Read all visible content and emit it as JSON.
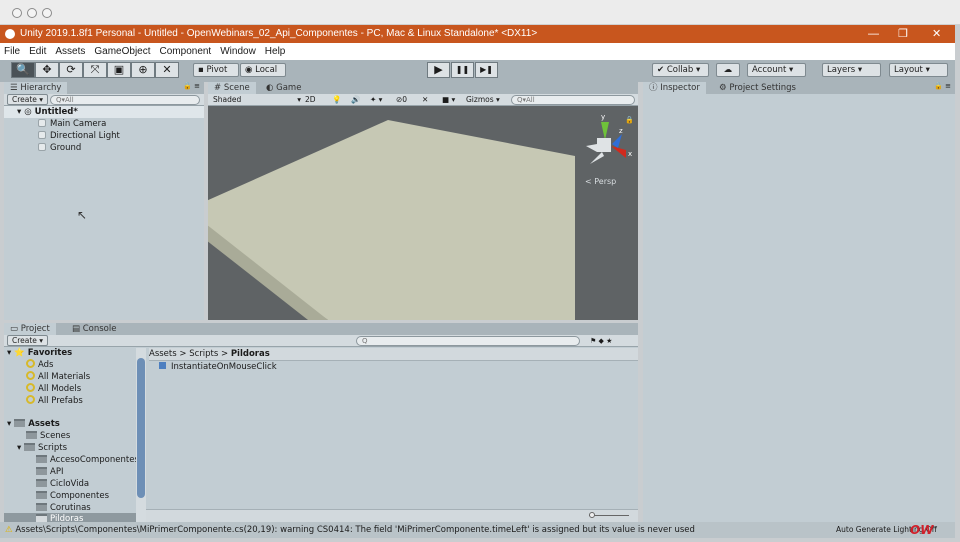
{
  "window": {
    "title": "Unity 2019.1.8f1 Personal - Untitled - OpenWebinars_02_Api_Componentes - PC, Mac & Linux Standalone* <DX11>",
    "minimize": "—",
    "restore": "❐",
    "close": "✕"
  },
  "menu": [
    "File",
    "Edit",
    "Assets",
    "GameObject",
    "Component",
    "Window",
    "Help"
  ],
  "toolbar": {
    "tools": [
      "🔍",
      "✥",
      "⟳",
      "⤧",
      "▣",
      "⊕",
      "✕"
    ],
    "pivot": "Pivot",
    "local": "Local",
    "play": "▶",
    "pause": "❚❚",
    "step": "▶❚",
    "collab": "Collab ▾",
    "account": "Account",
    "layers": "Layers",
    "layout": "Layout"
  },
  "hierarchy": {
    "tab": "Hierarchy",
    "create": "Create ▾",
    "search_placeholder": "Q▾All",
    "scene": "Untitled*",
    "items": [
      "Main Camera",
      "Directional Light",
      "Ground"
    ]
  },
  "scene": {
    "tabs": [
      "Scene",
      "Game"
    ],
    "shading": "Shaded",
    "mode_2d": "2D",
    "effects_count": "0",
    "gizmos": "Gizmos ▾",
    "search_placeholder": "Q▾All",
    "persp": "Persp",
    "axes": {
      "x": "x",
      "y": "y",
      "z": "z"
    },
    "colors": {
      "background": "#5f6365",
      "plane": "#c6c8b4"
    }
  },
  "inspector": {
    "tabs": [
      "Inspector",
      "Project Settings"
    ]
  },
  "project": {
    "tabs": [
      "Project",
      "Console"
    ],
    "create": "Create ▾",
    "favorites": {
      "label": "Favorites",
      "items": [
        "Ads",
        "All Materials",
        "All Models",
        "All Prefabs"
      ]
    },
    "assets": {
      "label": "Assets",
      "items": [
        {
          "name": "Scenes",
          "depth": 1
        },
        {
          "name": "Scripts",
          "depth": 1
        },
        {
          "name": "AccesoComponentes",
          "depth": 2
        },
        {
          "name": "API",
          "depth": 2
        },
        {
          "name": "CicloVida",
          "depth": 2
        },
        {
          "name": "Componentes",
          "depth": 2
        },
        {
          "name": "Corutinas",
          "depth": 2
        },
        {
          "name": "Pildoras",
          "depth": 2,
          "selected": true
        }
      ]
    },
    "breadcrumb": [
      "Assets",
      "Scripts",
      "Pildoras"
    ],
    "files": [
      "InstantiateOnMouseClick"
    ]
  },
  "status": {
    "message": "Assets\\Scripts\\Componentes\\MiPrimerComponente.cs(20,19): warning CS0414: The field 'MiPrimerComponente.timeLeft' is assigned but its value is never used",
    "lighting": "Auto Generate Lighting Off",
    "watermark": "OW"
  }
}
